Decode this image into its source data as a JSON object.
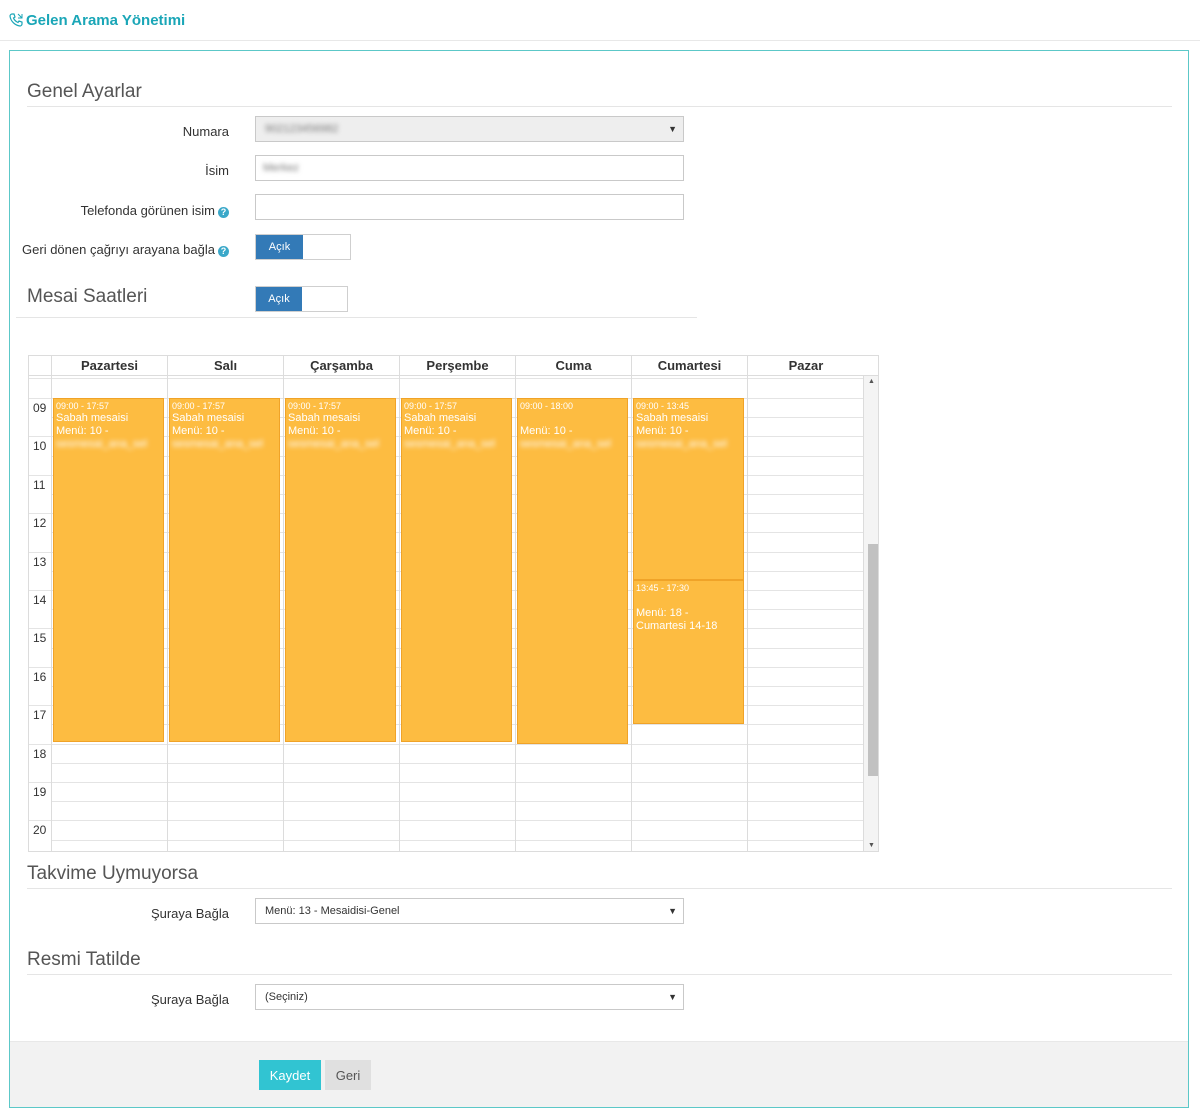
{
  "header": {
    "title": "Gelen Arama Yönetimi",
    "icon": "phone-icon",
    "accent": "#1aa6b7"
  },
  "general": {
    "title": "Genel Ayarlar",
    "number_label": "Numara",
    "number_value": "902123456982",
    "name_label": "İsim",
    "name_value": "Merkez",
    "display_name_label": "Telefonda görünen isim",
    "display_name_value": "",
    "callback_label": "Geri dönen çağrıyı arayana bağla",
    "callback_toggle": "Açık"
  },
  "hours": {
    "title": "Mesai Saatleri",
    "toggle": "Açık",
    "days": [
      "Pazartesi",
      "Salı",
      "Çarşamba",
      "Perşembe",
      "Cuma",
      "Cumartesi",
      "Pazar"
    ],
    "hour_labels": [
      "09",
      "10",
      "11",
      "12",
      "13",
      "14",
      "15",
      "16",
      "17",
      "18",
      "19",
      "20"
    ],
    "events": [
      {
        "day": 0,
        "start": 9.0,
        "end": 17.95,
        "time": "09:00 - 17:57",
        "title": "Sabah mesaisi",
        "menu": "Menü: 10 -",
        "sub": "sesmesai_ana_sel"
      },
      {
        "day": 1,
        "start": 9.0,
        "end": 17.95,
        "time": "09:00 - 17:57",
        "title": "Sabah mesaisi",
        "menu": "Menü: 10 -",
        "sub": "sesmesai_ana_sel"
      },
      {
        "day": 2,
        "start": 9.0,
        "end": 17.95,
        "time": "09:00 - 17:57",
        "title": "Sabah mesaisi",
        "menu": "Menü: 10 -",
        "sub": "sesmesai_ana_sel"
      },
      {
        "day": 3,
        "start": 9.0,
        "end": 17.95,
        "time": "09:00 - 17:57",
        "title": "Sabah mesaisi",
        "menu": "Menü: 10 -",
        "sub": "sesmesai_ana_sel"
      },
      {
        "day": 4,
        "start": 9.0,
        "end": 18.0,
        "time": "09:00 - 18:00",
        "title": "",
        "menu": "Menü: 10 -",
        "sub": "sesmesai_ana_sel"
      },
      {
        "day": 5,
        "start": 9.0,
        "end": 13.75,
        "time": "09:00 - 13:45",
        "title": "Sabah mesaisi",
        "menu": "Menü: 10 -",
        "sub": "sesmesai_ana_sel"
      },
      {
        "day": 5,
        "start": 13.75,
        "end": 17.5,
        "time": "13:45 - 17:30",
        "title": "",
        "menu": "Menü: 18 - Cumartesi 14-18",
        "sub": ""
      }
    ],
    "event_color": "#fdbc41"
  },
  "calendar_mismatch": {
    "title": "Takvime Uymuyorsa",
    "label": "Şuraya Bağla",
    "value": "Menü: 13 - Mesaidisi-Genel"
  },
  "holiday": {
    "title": "Resmi Tatilde",
    "label": "Şuraya Bağla",
    "value": "(Seçiniz)"
  },
  "actions": {
    "save": "Kaydet",
    "back": "Geri"
  }
}
